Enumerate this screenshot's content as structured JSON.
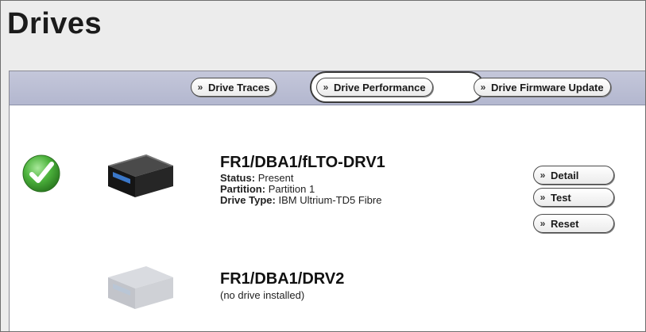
{
  "page": {
    "title": "Drives"
  },
  "toolbar": {
    "buttons": [
      {
        "label": "Drive Traces",
        "icon": "double-chevron-right-icon"
      },
      {
        "label": "Drive Performance",
        "icon": "double-chevron-right-icon",
        "highlighted": true
      },
      {
        "label": "Drive Firmware Update",
        "icon": "double-chevron-right-icon"
      }
    ]
  },
  "drives": [
    {
      "name": "FR1/DBA1/fLTO-DRV1",
      "status_icon": "green-check-icon",
      "status_label": "Status:",
      "status_value": "Present",
      "partition_label": "Partition:",
      "partition_value": "Partition 1",
      "type_label": "Drive Type:",
      "type_value": "IBM Ultrium-TD5 Fibre",
      "actions": [
        {
          "label": "Detail"
        },
        {
          "label": "Test"
        },
        {
          "label": "Reset"
        }
      ]
    },
    {
      "name": "FR1/DBA1/DRV2",
      "note": "(no drive installed)"
    }
  ],
  "colors": {
    "toolbar_bg": "#b8bcd2",
    "check_green": "#3fa032",
    "drive_dark": "#1f1f1f",
    "drive_faded": "#c9cbd0"
  }
}
